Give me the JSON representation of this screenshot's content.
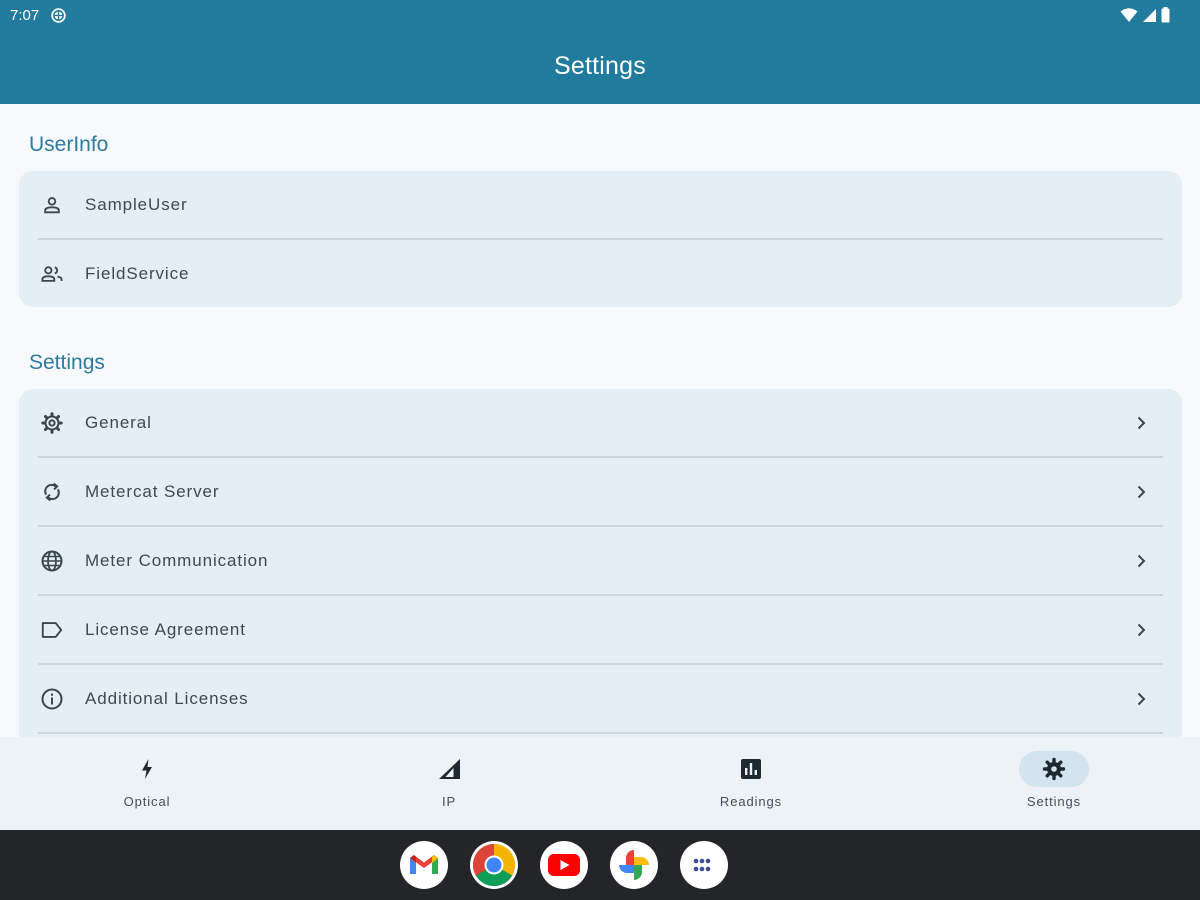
{
  "status_bar": {
    "time": "7:07"
  },
  "app_bar": {
    "title": "Settings"
  },
  "userinfo": {
    "title": "UserInfo",
    "items": [
      {
        "label": "SampleUser",
        "icon": "person-icon"
      },
      {
        "label": "FieldService",
        "icon": "group-icon"
      }
    ]
  },
  "settings": {
    "title": "Settings",
    "items": [
      {
        "label": "General",
        "icon": "gear-icon"
      },
      {
        "label": "Metercat Server",
        "icon": "sync-icon"
      },
      {
        "label": "Meter Communication",
        "icon": "globe-icon"
      },
      {
        "label": "License Agreement",
        "icon": "label-icon"
      },
      {
        "label": "Additional Licenses",
        "icon": "info-icon"
      }
    ]
  },
  "bottom_nav": {
    "active": "Settings",
    "items": [
      {
        "label": "Optical",
        "icon": "bolt-icon"
      },
      {
        "label": "IP",
        "icon": "signal-icon"
      },
      {
        "label": "Readings",
        "icon": "bar-chart-icon"
      },
      {
        "label": "Settings",
        "icon": "gear-icon"
      }
    ]
  },
  "taskbar": {
    "apps": [
      {
        "name": "gmail",
        "icon": "gmail-icon"
      },
      {
        "name": "chrome",
        "icon": "chrome-icon"
      },
      {
        "name": "youtube",
        "icon": "youtube-icon"
      },
      {
        "name": "photos",
        "icon": "photos-icon"
      },
      {
        "name": "app-drawer",
        "icon": "app-drawer-icon"
      }
    ]
  },
  "colors": {
    "primary": "#207b9d",
    "section_title": "#2c7ca0",
    "card_bg": "#e3eef5",
    "nav_active_pill": "#d3e4ef"
  }
}
